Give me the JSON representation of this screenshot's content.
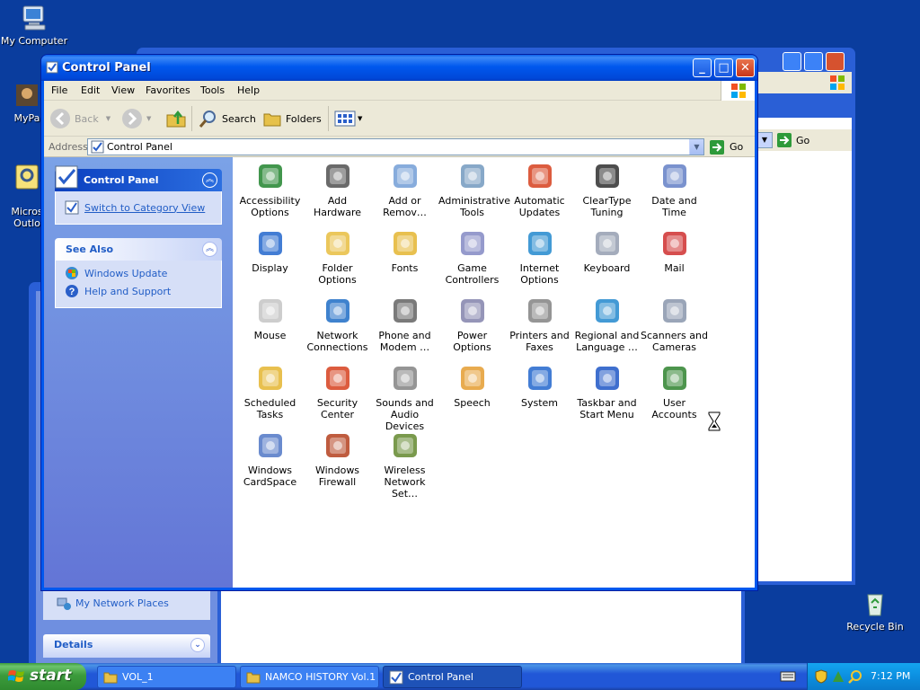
{
  "desktop": {
    "icons": [
      {
        "label": "My Computer",
        "icon": "my-computer-icon"
      },
      {
        "label": "MyPa",
        "icon": "folder-icon"
      },
      {
        "label": "Micros\nOutlo",
        "icon": "outlook-icon"
      },
      {
        "label": "Recycle Bin",
        "icon": "recycle-bin-icon"
      }
    ]
  },
  "back_window": {
    "go_label": "Go",
    "side_items": {
      "network_places": "My Network Places",
      "details": "Details"
    }
  },
  "window": {
    "title": "Control Panel",
    "menu": [
      "File",
      "Edit",
      "View",
      "Favorites",
      "Tools",
      "Help"
    ],
    "toolbar": {
      "back": "Back",
      "search": "Search",
      "folders": "Folders"
    },
    "address": {
      "label": "Address",
      "value": "Control Panel",
      "go": "Go"
    },
    "side": {
      "control_panel_title": "Control Panel",
      "switch_link": "Switch to Category View",
      "see_also_title": "See Also",
      "see_also": [
        "Windows Update",
        "Help and Support"
      ]
    },
    "items": [
      {
        "label": "Accessibility Options",
        "icon": "accessibility-icon",
        "color": "#2e8b3a"
      },
      {
        "label": "Add Hardware",
        "icon": "hardware-icon",
        "color": "#5a5a5a"
      },
      {
        "label": "Add or Remov…",
        "icon": "cd-box-icon",
        "color": "#7aa3d8"
      },
      {
        "label": "Administrative Tools",
        "icon": "admin-tools-icon",
        "color": "#7a9ec2"
      },
      {
        "label": "Automatic Updates",
        "icon": "windows-globe-icon",
        "color": "#d84a2a"
      },
      {
        "label": "ClearType Tuning",
        "icon": "cleartype-icon",
        "color": "#3a3a3a"
      },
      {
        "label": "Date and Time",
        "icon": "calendar-clock-icon",
        "color": "#6b86c9"
      },
      {
        "label": "Display",
        "icon": "display-icon",
        "color": "#2f6fcf"
      },
      {
        "label": "Folder Options",
        "icon": "folder-options-icon",
        "color": "#e9c14a"
      },
      {
        "label": "Fonts",
        "icon": "fonts-folder-icon",
        "color": "#e6b93c"
      },
      {
        "label": "Game Controllers",
        "icon": "gamepad-icon",
        "color": "#8a8fc7"
      },
      {
        "label": "Internet Options",
        "icon": "internet-globe-icon",
        "color": "#2f8fd0"
      },
      {
        "label": "Keyboard",
        "icon": "keyboard-icon",
        "color": "#9aa3b5"
      },
      {
        "label": "Mail",
        "icon": "mail-icon",
        "color": "#d13b3b"
      },
      {
        "label": "Mouse",
        "icon": "mouse-icon",
        "color": "#c8c8c8"
      },
      {
        "label": "Network Connections",
        "icon": "network-globe-icon",
        "color": "#2a74c9"
      },
      {
        "label": "Phone and Modem …",
        "icon": "phone-icon",
        "color": "#6b6b6b"
      },
      {
        "label": "Power Options",
        "icon": "power-plug-icon",
        "color": "#8a8ab0"
      },
      {
        "label": "Printers and Faxes",
        "icon": "printer-icon",
        "color": "#8a8a8a"
      },
      {
        "label": "Regional and Language …",
        "icon": "regional-globe-icon",
        "color": "#2f8fd0"
      },
      {
        "label": "Scanners and Cameras",
        "icon": "scanner-camera-icon",
        "color": "#8f9bb0"
      },
      {
        "label": "Scheduled Tasks",
        "icon": "scheduled-tasks-icon",
        "color": "#e6b93c"
      },
      {
        "label": "Security Center",
        "icon": "security-shield-icon",
        "color": "#d84a2a"
      },
      {
        "label": "Sounds and Audio Devices",
        "icon": "speaker-icon",
        "color": "#8a8a8a"
      },
      {
        "label": "Speech",
        "icon": "speech-icon",
        "color": "#e6a23c"
      },
      {
        "label": "System",
        "icon": "system-icon",
        "color": "#2f6fcf"
      },
      {
        "label": "Taskbar and Start Menu",
        "icon": "taskbar-icon",
        "color": "#2a5fc9"
      },
      {
        "label": "User Accounts",
        "icon": "user-accounts-icon",
        "color": "#3a8a3a"
      },
      {
        "label": "Windows CardSpace",
        "icon": "cardspace-icon",
        "color": "#5a7ec9"
      },
      {
        "label": "Windows Firewall",
        "icon": "firewall-icon",
        "color": "#b84a2a"
      },
      {
        "label": "Wireless Network Set…",
        "icon": "wireless-icon",
        "color": "#6b8f3a"
      }
    ]
  },
  "taskbar": {
    "start": "start",
    "tasks": [
      {
        "label": "VOL_1",
        "icon": "folder-icon"
      },
      {
        "label": "NAMCO HISTORY Vol.1",
        "icon": "folder-icon"
      },
      {
        "label": "Control Panel",
        "icon": "control-panel-icon"
      }
    ],
    "clock": "7:12 PM"
  }
}
